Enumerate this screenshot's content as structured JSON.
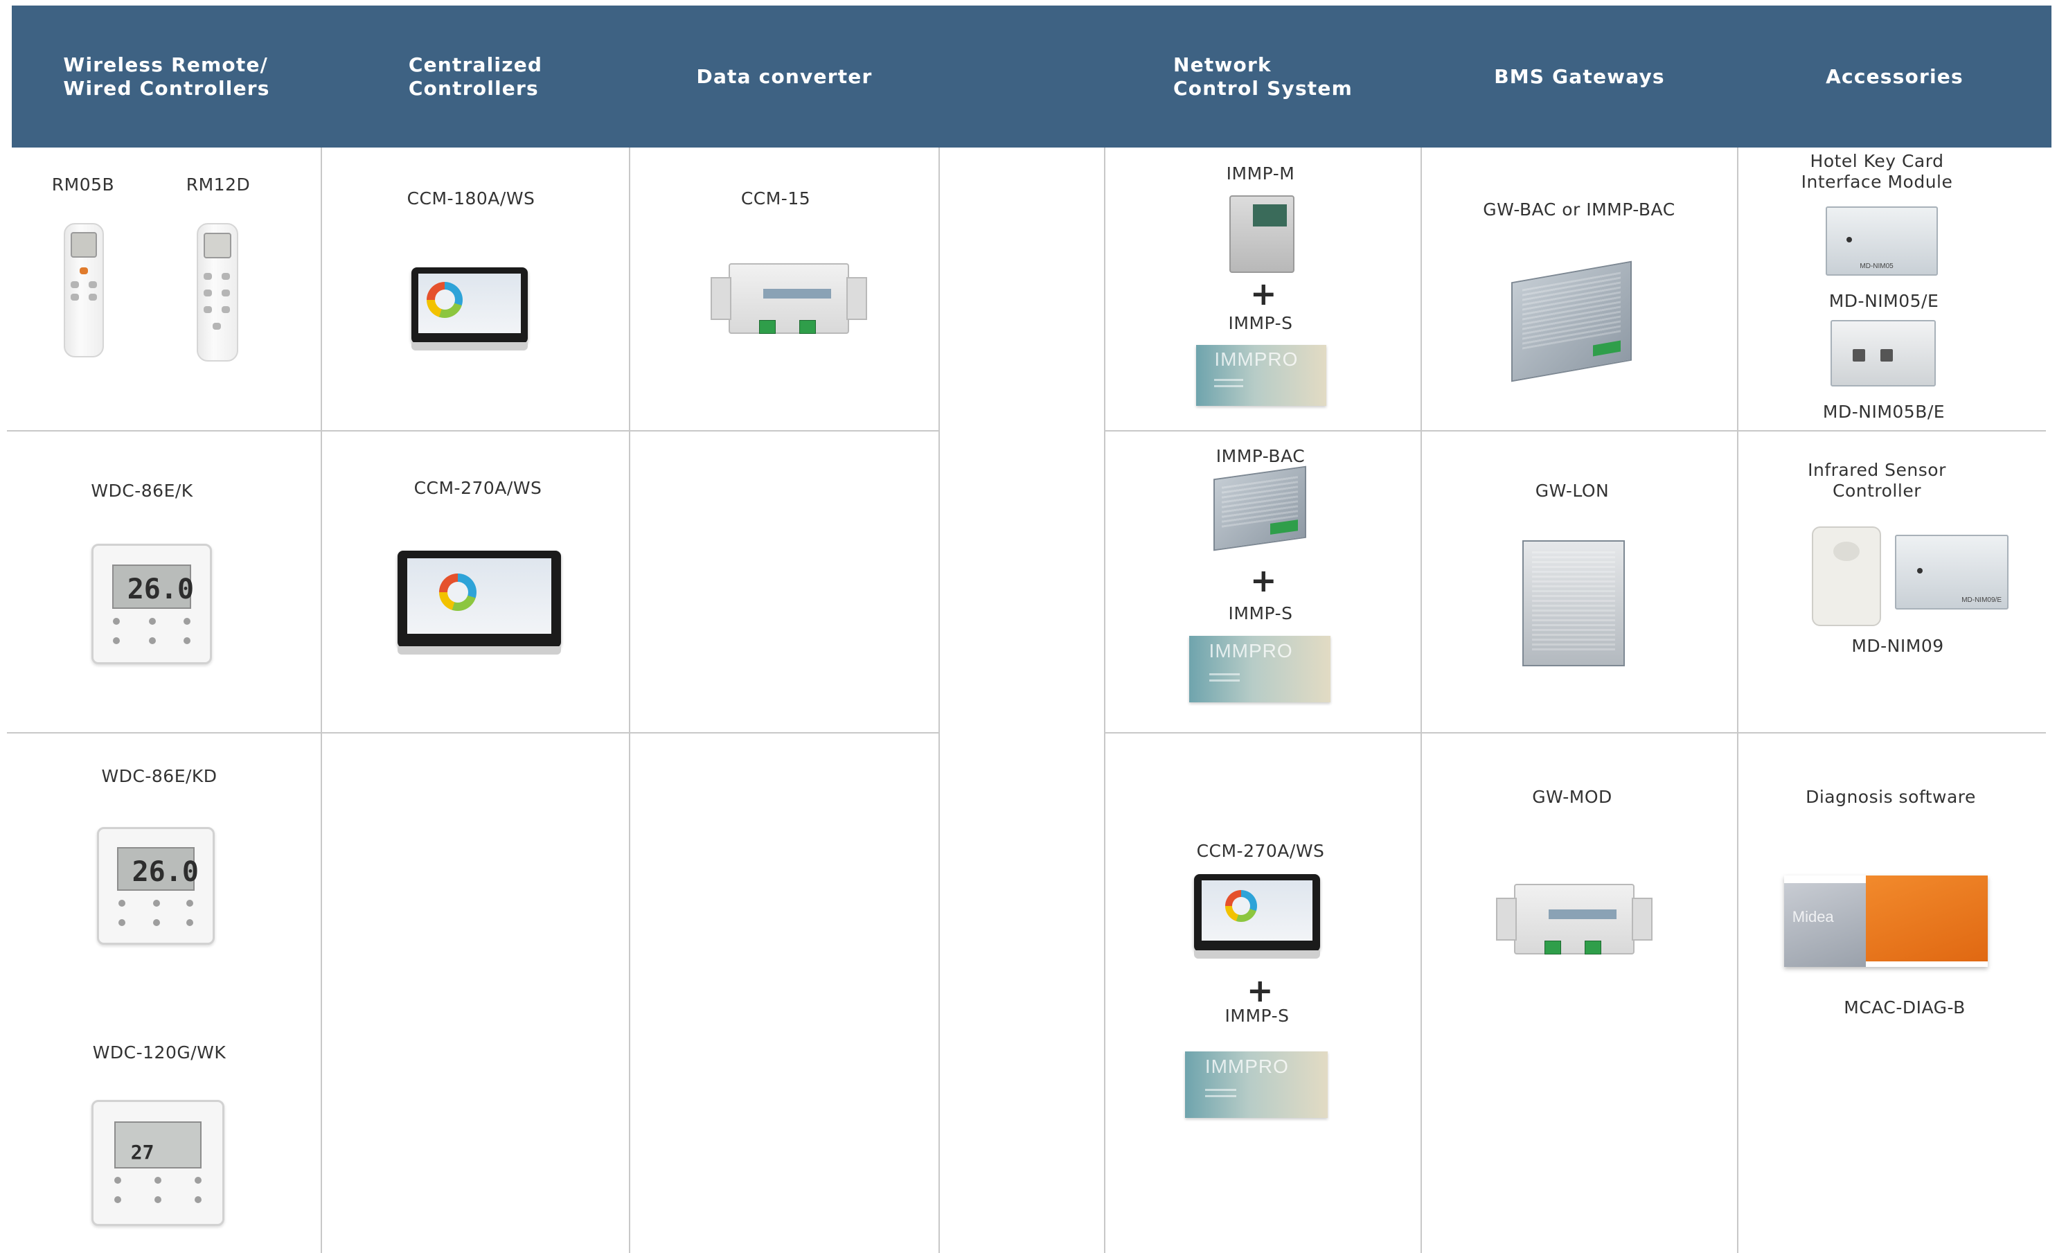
{
  "header": {
    "columns": [
      {
        "label": "Wireless Remote/\nWired Controllers"
      },
      {
        "label": "Centralized\nControllers"
      },
      {
        "label": "Data converter"
      },
      {
        "label": ""
      },
      {
        "label": "Network\nControl System"
      },
      {
        "label": "BMS Gateways"
      },
      {
        "label": "Accessories"
      }
    ]
  },
  "products": {
    "rm05b": "RM05B",
    "rm12d": "RM12D",
    "wdc86ek": "WDC-86E/K",
    "wdc86ekd": "WDC-86E/KD",
    "wdc120gwk": "WDC-120G/WK",
    "ccm180aws": "CCM-180A/WS",
    "ccm270aws": "CCM-270A/WS",
    "ccm15": "CCM-15",
    "immpm": "IMMP-M",
    "immps_1": "IMMP-S",
    "immpbac": "IMMP-BAC",
    "immps_2": "IMMP-S",
    "ccm270aws_net": "CCM-270A/WS",
    "immps_3": "IMMP-S",
    "gwbac": "GW-BAC or IMMP-BAC",
    "gwlon": "GW-LON",
    "gwmod": "GW-MOD",
    "hotelkey": "Hotel Key Card\nInterface Module",
    "mdnim05e": "MD-NIM05/E",
    "mdnim05be": "MD-NIM05B/E",
    "infrared": "Infrared Sensor\nController",
    "mdnim09": "MD-NIM09",
    "diagsw": "Diagnosis software",
    "mcacdiagb": "MCAC-DIAG-B"
  },
  "symbols": {
    "plus": "+"
  },
  "device_text": {
    "lcd_reading": "26.0",
    "lcd_reading_2": "27",
    "immpro": "IMMPRO",
    "brand": "Midea",
    "nim05_tag": "MD-NIM05",
    "nim09_tag": "MD-NIM09/E",
    "converter_text": "Data Converter"
  },
  "colors": {
    "header_bg": "#3e6283",
    "grid_line": "#c8c8c8",
    "accent_orange": "#e06812"
  }
}
